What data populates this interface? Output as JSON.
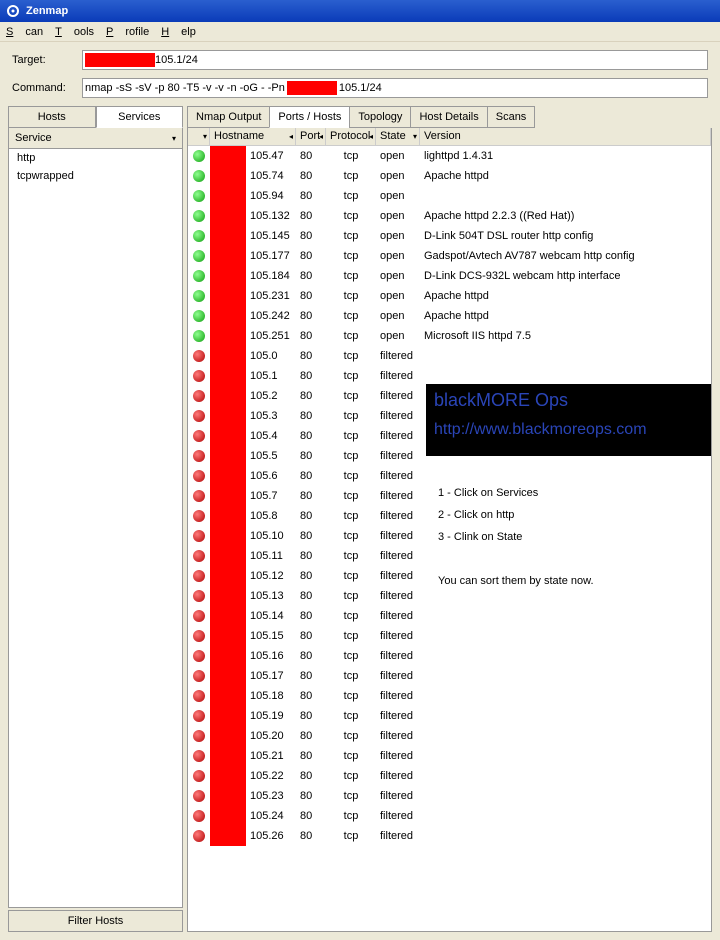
{
  "window": {
    "title": "Zenmap"
  },
  "menu": {
    "scan": "Scan",
    "tools": "Tools",
    "profile": "Profile",
    "help": "Help"
  },
  "toolbar": {
    "target_label": "Target:",
    "target_value": "105.1/24",
    "command_label": "Command:",
    "command_value_prefix": "nmap -sS -sV -p 80 -T5 -v -v -n -oG - -Pn",
    "command_value_suffix": "105.1/24"
  },
  "left_tabs": {
    "hosts": "Hosts",
    "services": "Services"
  },
  "sidebar": {
    "header": "Service",
    "items": [
      "http",
      "tcpwrapped"
    ],
    "filter_button": "Filter Hosts"
  },
  "result_tabs": [
    "Nmap Output",
    "Ports / Hosts",
    "Topology",
    "Host Details",
    "Scans"
  ],
  "result_tabs_active": 1,
  "grid": {
    "columns": [
      "",
      "Hostname",
      "Port",
      "Protocol",
      "State",
      "Version"
    ],
    "rows": [
      {
        "status": "green",
        "host": "105.47",
        "port": "80",
        "proto": "tcp",
        "state": "open",
        "ver": "lighttpd 1.4.31"
      },
      {
        "status": "green",
        "host": "105.74",
        "port": "80",
        "proto": "tcp",
        "state": "open",
        "ver": "Apache httpd"
      },
      {
        "status": "green",
        "host": "105.94",
        "port": "80",
        "proto": "tcp",
        "state": "open",
        "ver": ""
      },
      {
        "status": "green",
        "host": "105.132",
        "port": "80",
        "proto": "tcp",
        "state": "open",
        "ver": "Apache httpd 2.2.3 ((Red Hat))"
      },
      {
        "status": "green",
        "host": "105.145",
        "port": "80",
        "proto": "tcp",
        "state": "open",
        "ver": "D-Link 504T DSL router http config"
      },
      {
        "status": "green",
        "host": "105.177",
        "port": "80",
        "proto": "tcp",
        "state": "open",
        "ver": "Gadspot/Avtech AV787 webcam http config"
      },
      {
        "status": "green",
        "host": "105.184",
        "port": "80",
        "proto": "tcp",
        "state": "open",
        "ver": "D-Link DCS-932L webcam http interface"
      },
      {
        "status": "green",
        "host": "105.231",
        "port": "80",
        "proto": "tcp",
        "state": "open",
        "ver": "Apache httpd"
      },
      {
        "status": "green",
        "host": "105.242",
        "port": "80",
        "proto": "tcp",
        "state": "open",
        "ver": "Apache httpd"
      },
      {
        "status": "green",
        "host": "105.251",
        "port": "80",
        "proto": "tcp",
        "state": "open",
        "ver": "Microsoft IIS httpd 7.5"
      },
      {
        "status": "red",
        "host": "105.0",
        "port": "80",
        "proto": "tcp",
        "state": "filtered",
        "ver": ""
      },
      {
        "status": "red",
        "host": "105.1",
        "port": "80",
        "proto": "tcp",
        "state": "filtered",
        "ver": ""
      },
      {
        "status": "red",
        "host": "105.2",
        "port": "80",
        "proto": "tcp",
        "state": "filtered",
        "ver": ""
      },
      {
        "status": "red",
        "host": "105.3",
        "port": "80",
        "proto": "tcp",
        "state": "filtered",
        "ver": ""
      },
      {
        "status": "red",
        "host": "105.4",
        "port": "80",
        "proto": "tcp",
        "state": "filtered",
        "ver": ""
      },
      {
        "status": "red",
        "host": "105.5",
        "port": "80",
        "proto": "tcp",
        "state": "filtered",
        "ver": ""
      },
      {
        "status": "red",
        "host": "105.6",
        "port": "80",
        "proto": "tcp",
        "state": "filtered",
        "ver": ""
      },
      {
        "status": "red",
        "host": "105.7",
        "port": "80",
        "proto": "tcp",
        "state": "filtered",
        "ver": ""
      },
      {
        "status": "red",
        "host": "105.8",
        "port": "80",
        "proto": "tcp",
        "state": "filtered",
        "ver": ""
      },
      {
        "status": "red",
        "host": "105.10",
        "port": "80",
        "proto": "tcp",
        "state": "filtered",
        "ver": ""
      },
      {
        "status": "red",
        "host": "105.11",
        "port": "80",
        "proto": "tcp",
        "state": "filtered",
        "ver": ""
      },
      {
        "status": "red",
        "host": "105.12",
        "port": "80",
        "proto": "tcp",
        "state": "filtered",
        "ver": ""
      },
      {
        "status": "red",
        "host": "105.13",
        "port": "80",
        "proto": "tcp",
        "state": "filtered",
        "ver": ""
      },
      {
        "status": "red",
        "host": "105.14",
        "port": "80",
        "proto": "tcp",
        "state": "filtered",
        "ver": ""
      },
      {
        "status": "red",
        "host": "105.15",
        "port": "80",
        "proto": "tcp",
        "state": "filtered",
        "ver": ""
      },
      {
        "status": "red",
        "host": "105.16",
        "port": "80",
        "proto": "tcp",
        "state": "filtered",
        "ver": ""
      },
      {
        "status": "red",
        "host": "105.17",
        "port": "80",
        "proto": "tcp",
        "state": "filtered",
        "ver": ""
      },
      {
        "status": "red",
        "host": "105.18",
        "port": "80",
        "proto": "tcp",
        "state": "filtered",
        "ver": ""
      },
      {
        "status": "red",
        "host": "105.19",
        "port": "80",
        "proto": "tcp",
        "state": "filtered",
        "ver": ""
      },
      {
        "status": "red",
        "host": "105.20",
        "port": "80",
        "proto": "tcp",
        "state": "filtered",
        "ver": ""
      },
      {
        "status": "red",
        "host": "105.21",
        "port": "80",
        "proto": "tcp",
        "state": "filtered",
        "ver": ""
      },
      {
        "status": "red",
        "host": "105.22",
        "port": "80",
        "proto": "tcp",
        "state": "filtered",
        "ver": ""
      },
      {
        "status": "red",
        "host": "105.23",
        "port": "80",
        "proto": "tcp",
        "state": "filtered",
        "ver": ""
      },
      {
        "status": "red",
        "host": "105.24",
        "port": "80",
        "proto": "tcp",
        "state": "filtered",
        "ver": ""
      },
      {
        "status": "red",
        "host": "105.26",
        "port": "80",
        "proto": "tcp",
        "state": "filtered",
        "ver": ""
      }
    ]
  },
  "overlay": {
    "title": "blackMORE Ops",
    "url": "http://www.blackmoreops.com",
    "instructions": [
      "1 - Click on Services",
      "2 - Click on http",
      "3 - Clink on State",
      "",
      "You can sort them by state now."
    ]
  }
}
